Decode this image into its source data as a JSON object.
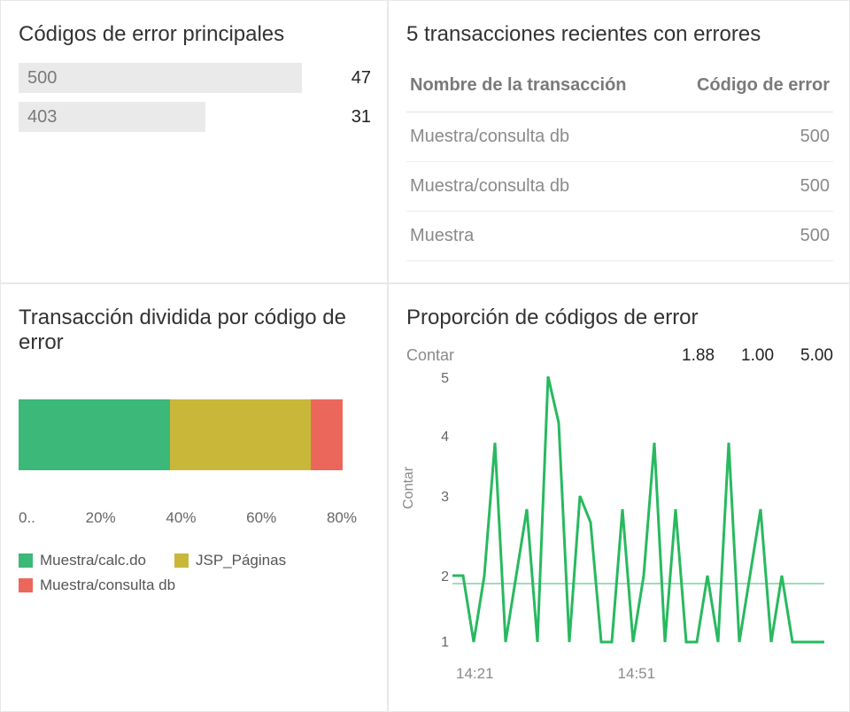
{
  "panels": {
    "top_left": {
      "title": "Códigos de error principales"
    },
    "top_right": {
      "title": "5 transacciones recientes con errores",
      "col1": "Nombre de la transacción",
      "col2": "Código de error",
      "rows": [
        {
          "name": "Muestra/consulta db",
          "code": "500"
        },
        {
          "name": "Muestra/consulta db",
          "code": "500"
        },
        {
          "name": "Muestra",
          "code": "500"
        }
      ]
    },
    "bot_left": {
      "title": "Transacción dividida por código de error",
      "axis": [
        "0..",
        "20%",
        "40%",
        "60%",
        "80%"
      ],
      "legend": [
        {
          "label": "Muestra/calc.do",
          "color": "#3cb878"
        },
        {
          "label": "JSP_Páginas",
          "color": "#c9b73a"
        },
        {
          "label": "Muestra/consulta db",
          "color": "#ec675b"
        }
      ]
    },
    "bot_right": {
      "title": "Proporción de códigos de error",
      "metric_label": "Contar",
      "metrics": [
        "1.88",
        "1.00",
        "5.00"
      ],
      "ylabel": "Contar",
      "xticks": [
        "14:21",
        "14:51"
      ]
    }
  },
  "chart_data": [
    {
      "type": "bar",
      "title": "Códigos de error principales",
      "orientation": "horizontal",
      "categories": [
        "500",
        "403"
      ],
      "values": [
        47,
        31
      ],
      "xlim": [
        0,
        47
      ]
    },
    {
      "type": "table",
      "title": "5 transacciones recientes con errores",
      "columns": [
        "Nombre de la transacción",
        "Código de error"
      ],
      "rows": [
        [
          "Muestra/consulta db",
          500
        ],
        [
          "Muestra/consulta db",
          500
        ],
        [
          "Muestra",
          500
        ]
      ]
    },
    {
      "type": "bar",
      "title": "Transacción dividida por código de error",
      "stacked": true,
      "orientation": "horizontal",
      "percent": true,
      "categories": [
        ""
      ],
      "series": [
        {
          "name": "Muestra/calc.do",
          "color": "#3cb878",
          "values": [
            43
          ]
        },
        {
          "name": "JSP_Páginas",
          "color": "#c9b73a",
          "values": [
            40
          ]
        },
        {
          "name": "Muestra/consulta db",
          "color": "#ec675b",
          "values": [
            9
          ]
        }
      ],
      "xlabel": "",
      "xticks": [
        "0..",
        "20%",
        "40%",
        "60%",
        "80%"
      ]
    },
    {
      "type": "line",
      "title": "Proporción de códigos de error",
      "ylabel": "Contar",
      "ylim": [
        1,
        5
      ],
      "reference_line": 1.88,
      "summary": {
        "avg": 1.88,
        "min": 1.0,
        "max": 5.0
      },
      "x": [
        "14:21",
        "14:23",
        "14:25",
        "14:27",
        "14:29",
        "14:31",
        "14:33",
        "14:35",
        "14:37",
        "14:39",
        "14:41",
        "14:43",
        "14:45",
        "14:47",
        "14:49",
        "14:51",
        "14:53",
        "14:55",
        "14:57",
        "14:59",
        "15:01",
        "15:03",
        "15:05",
        "15:07",
        "15:09",
        "15:11",
        "15:13",
        "15:15",
        "15:17",
        "15:19",
        "15:21",
        "15:23",
        "15:25",
        "15:27",
        "15:29",
        "15:31"
      ],
      "values": [
        2,
        2,
        1,
        2,
        4,
        1,
        2,
        3,
        1,
        5,
        4.3,
        1,
        3.2,
        2.8,
        1,
        1,
        3,
        1,
        2,
        4,
        1,
        3,
        1,
        1,
        2,
        1,
        4,
        1,
        2,
        3,
        1,
        2,
        1,
        1,
        1,
        1
      ],
      "xticks": [
        "14:21",
        "14:51"
      ]
    }
  ]
}
